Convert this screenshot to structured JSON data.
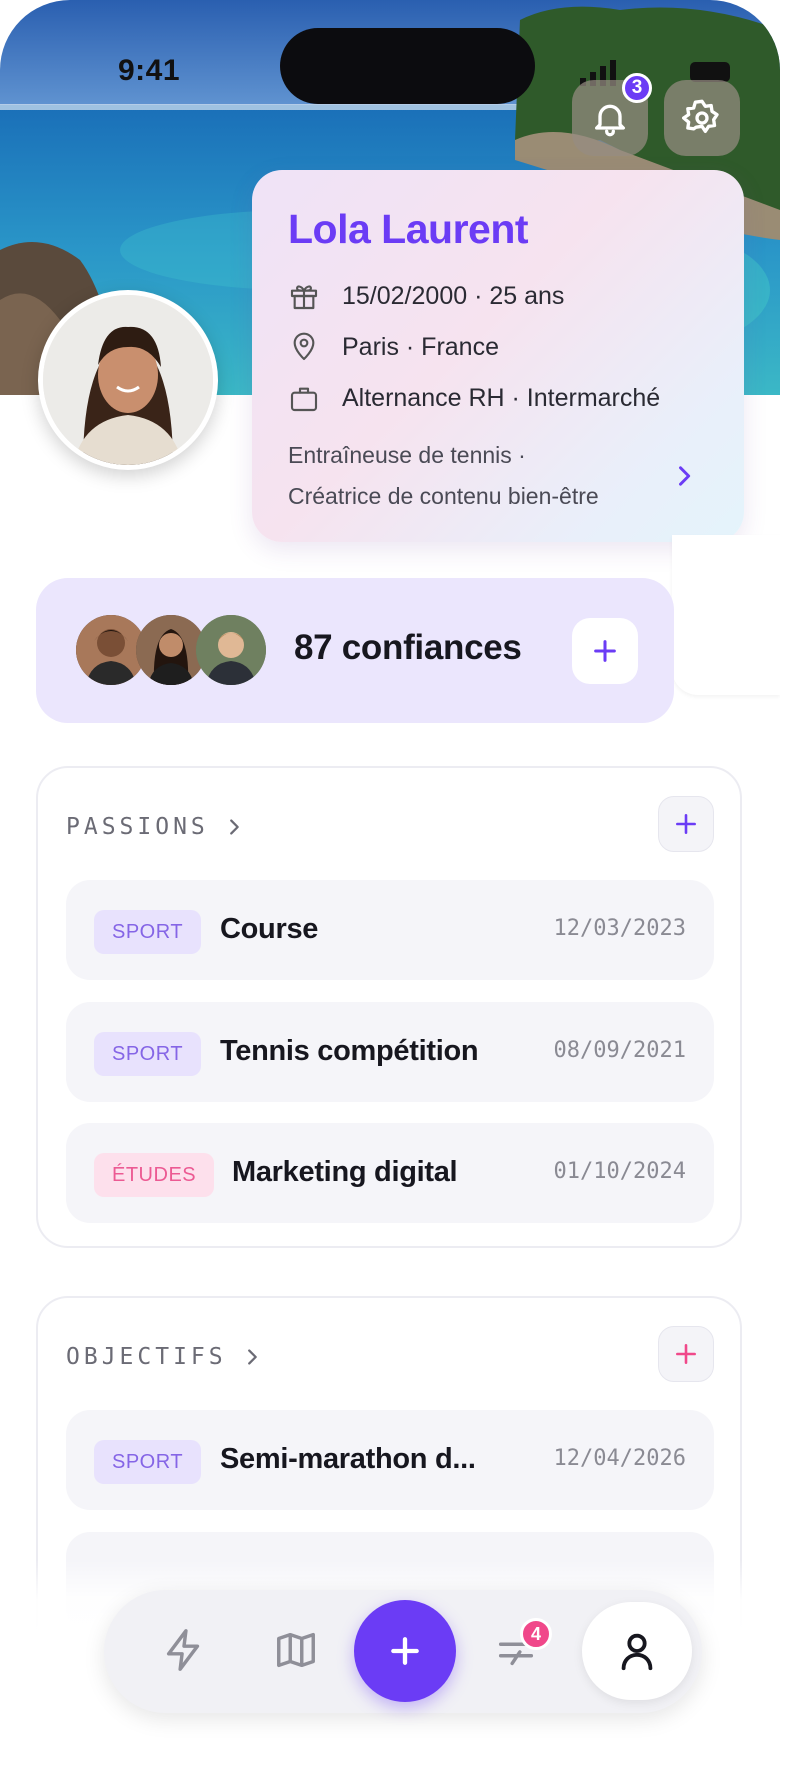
{
  "status_bar": {
    "time": "9:41"
  },
  "notifications": {
    "count": "3"
  },
  "profile": {
    "name": "Lola Laurent",
    "birth": "15/02/2000 · 25 ans",
    "location": "Paris · France",
    "job": "Alternance RH · Intermarché",
    "bio_line1": "Entraîneuse de tennis ·",
    "bio_line2": "Créatrice de contenu bien-être"
  },
  "trust": {
    "label": "87 confiances"
  },
  "passions": {
    "title": "PASSIONS",
    "items": [
      {
        "tag": "SPORT",
        "tag_type": "sport",
        "label": "Course",
        "date": "12/03/2023"
      },
      {
        "tag": "SPORT",
        "tag_type": "sport",
        "label": "Tennis compétition",
        "date": "08/09/2021"
      },
      {
        "tag": "ÉTUDES",
        "tag_type": "etudes",
        "label": "Marketing digital",
        "date": "01/10/2024"
      }
    ]
  },
  "objectifs": {
    "title": "OBJECTIFS",
    "items": [
      {
        "tag": "SPORT",
        "tag_type": "sport",
        "label": "Semi-marathon d...",
        "date": "12/04/2026"
      }
    ]
  },
  "tabbar": {
    "exchange_badge": "4"
  },
  "colors": {
    "accent": "#6b3cf5",
    "pink": "#f0488a",
    "trust_bg": "#ebe6fd"
  }
}
